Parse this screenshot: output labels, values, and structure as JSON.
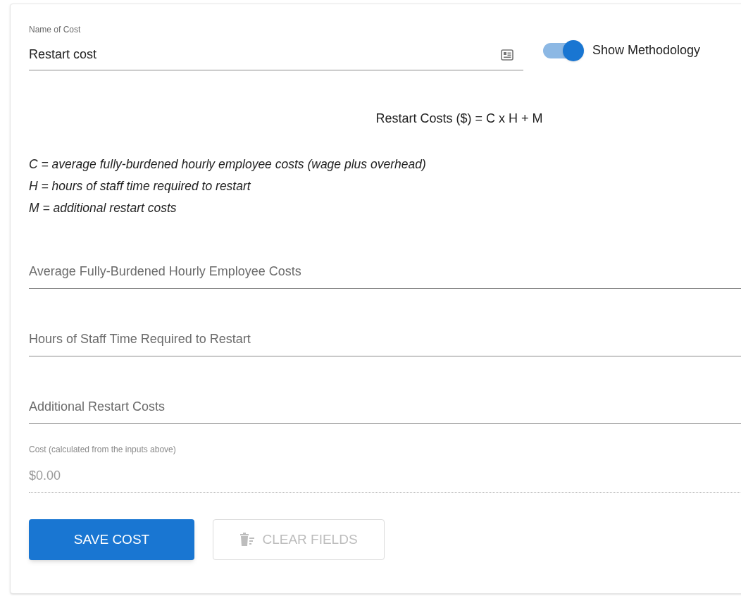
{
  "name_field": {
    "label": "Name of Cost",
    "value": "Restart cost"
  },
  "methodology_toggle": {
    "label": "Show Methodology",
    "on": true
  },
  "formula": "Restart Costs ($) = C x H + M",
  "definitions": [
    "C = average fully-burdened hourly employee costs (wage plus overhead)",
    "H = hours of staff time required to restart",
    "M = additional restart costs"
  ],
  "inputs": [
    {
      "placeholder": "Average Fully-Burdened Hourly Employee Costs"
    },
    {
      "placeholder": "Hours of Staff Time Required to Restart"
    },
    {
      "placeholder": "Additional Restart Costs"
    }
  ],
  "cost": {
    "label": "Cost (calculated from the inputs above)",
    "value": "$0.00",
    "disabled": true
  },
  "buttons": [
    {
      "label": "SAVE COST",
      "kind": "primary",
      "disabled": false
    },
    {
      "label": "CLEAR FIELDS",
      "kind": "clear",
      "disabled": true
    }
  ]
}
